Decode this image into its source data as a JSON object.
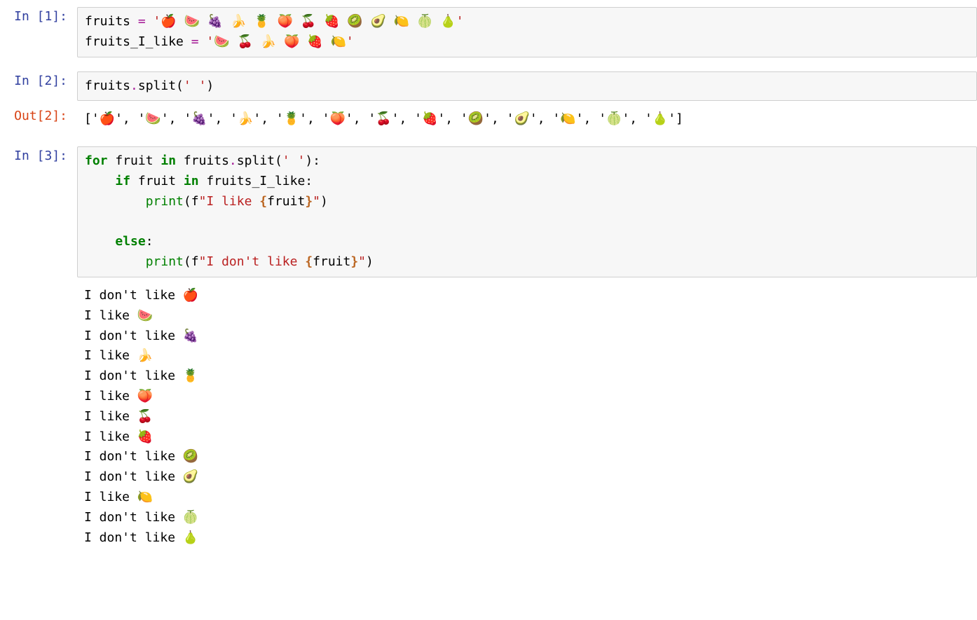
{
  "cells": {
    "cell1": {
      "prompt": "In [1]:",
      "line1_var": "fruits ",
      "line1_eq": "=",
      "line1_str": " '🍎 🍉 🍇 🍌 🍍 🍑 🍒 🍓 🥝 🥑 🍋 🍈 🍐'",
      "line2_var": "fruits_I_like ",
      "line2_eq": "=",
      "line2_str": " '🍉 🍒 🍌 🍑 🍓 🍋'"
    },
    "cell2": {
      "prompt": "In [2]:",
      "var1": "fruits",
      "dot": ".",
      "method": "split(",
      "arg": "' '",
      "close": ")"
    },
    "out2": {
      "prompt": "Out[2]:",
      "text": "['🍎', '🍉', '🍇', '🍌', '🍍', '🍑', '🍒', '🍓', '🥝', '🥑', '🍋', '🍈', '🍐']"
    },
    "cell3": {
      "prompt": "In [3]:",
      "for_kw": "for",
      "for_var": " fruit ",
      "in_kw": "in",
      "for_iter": " fruits",
      "for_dot": ".",
      "for_method": "split(",
      "for_arg": "' '",
      "for_close": "):",
      "if_indent": "    ",
      "if_kw": "if",
      "if_var": " fruit ",
      "if_in": "in",
      "if_target": " fruits_I_like:",
      "print1_indent": "        ",
      "print1_fn": "print",
      "print1_open": "(f",
      "print1_str_a": "\"I like ",
      "print1_interp_open": "{",
      "print1_interp_var": "fruit",
      "print1_interp_close": "}",
      "print1_str_b": "\"",
      "print1_close": ")",
      "else_indent": "    ",
      "else_kw": "else",
      "else_colon": ":",
      "print2_indent": "        ",
      "print2_fn": "print",
      "print2_open": "(f",
      "print2_str_a": "\"I don't like ",
      "print2_interp_open": "{",
      "print2_interp_var": "fruit",
      "print2_interp_close": "}",
      "print2_str_b": "\"",
      "print2_close": ")"
    },
    "out3": {
      "lines": "I don't like 🍎\nI like 🍉\nI don't like 🍇\nI like 🍌\nI don't like 🍍\nI like 🍑\nI like 🍒\nI like 🍓\nI don't like 🥝\nI don't like 🥑\nI like 🍋\nI don't like 🍈\nI don't like 🍐"
    }
  }
}
